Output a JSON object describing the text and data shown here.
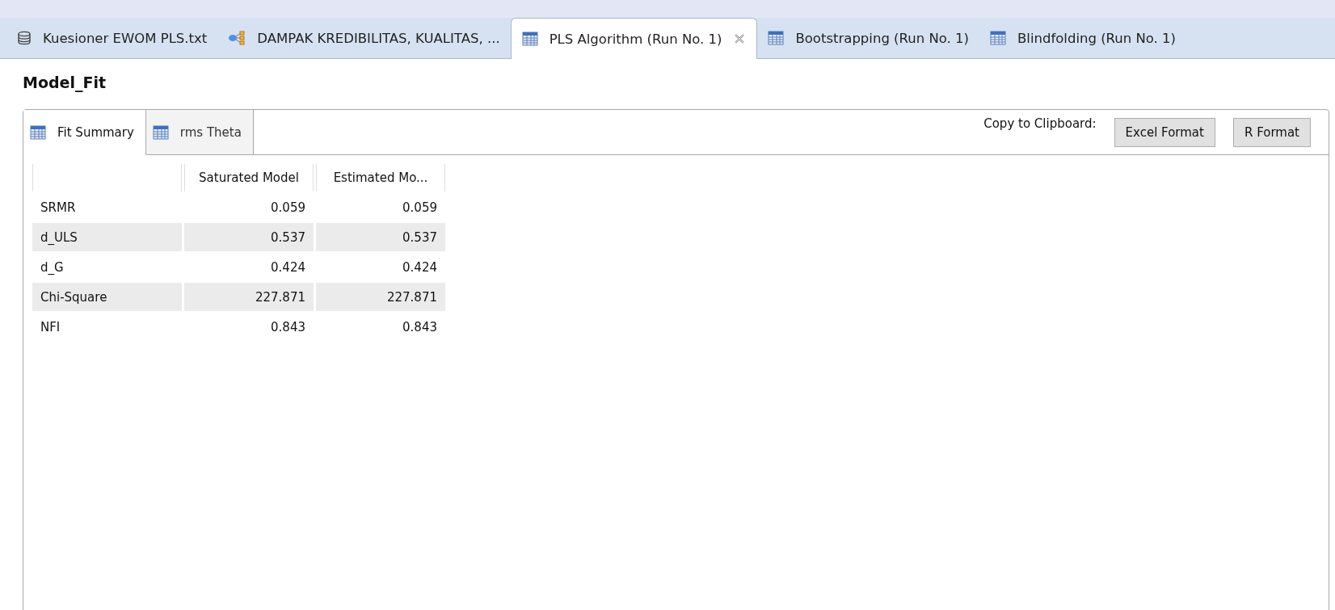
{
  "editor_tabs": [
    {
      "label": "Kuesioner EWOM PLS.txt",
      "kind": "database",
      "selected": false
    },
    {
      "label": "DAMPAK KREDIBILITAS, KUALITAS, ...",
      "kind": "diagram",
      "selected": false
    },
    {
      "label": "PLS Algorithm (Run No. 1)",
      "kind": "table",
      "selected": true
    },
    {
      "label": "Bootstrapping (Run No. 1)",
      "kind": "table",
      "selected": false
    },
    {
      "label": "Blindfolding (Run No. 1)",
      "kind": "table",
      "selected": false
    }
  ],
  "title": "Model_Fit",
  "view_tabs": [
    {
      "label": "Fit Summary",
      "selected": true
    },
    {
      "label": "rms Theta",
      "selected": false
    }
  ],
  "copy_label": "Copy to Clipboard:",
  "buttons": [
    "Excel Format",
    "R Format"
  ],
  "table": {
    "columns": [
      "Saturated Model",
      "Estimated Mo..."
    ],
    "rows": [
      {
        "label": "SRMR",
        "values": [
          "0.059",
          "0.059"
        ]
      },
      {
        "label": "d_ULS",
        "values": [
          "0.537",
          "0.537"
        ]
      },
      {
        "label": "d_G",
        "values": [
          "0.424",
          "0.424"
        ]
      },
      {
        "label": "Chi-Square",
        "values": [
          "227.871",
          "227.871"
        ]
      },
      {
        "label": "NFI",
        "values": [
          "0.843",
          "0.843"
        ]
      }
    ]
  }
}
